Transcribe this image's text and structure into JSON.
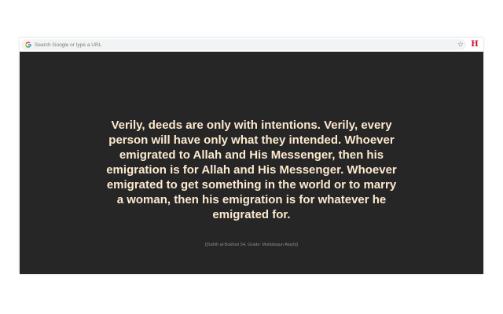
{
  "address_bar": {
    "placeholder": "Search Google or type a URL",
    "search_icon": "google-g-icon",
    "bookmark_icon": "star-icon"
  },
  "extension": {
    "label": "H",
    "color": "#c8102e"
  },
  "content": {
    "background": "#262626",
    "quote": "Verily, deeds are only with intentions. Verily, every person will have only what they intended. Whoever emigrated to Allah and His Messenger, then his emigration is for Allah and His Messenger. Whoever emigrated to get something in the world or to marry a woman, then his emigration is for whatever he emigrated for.",
    "quote_color": "#fde9cf",
    "source": "([Sahih al-Bukhari 54, Grade: Muttafaqun Alayh])"
  }
}
